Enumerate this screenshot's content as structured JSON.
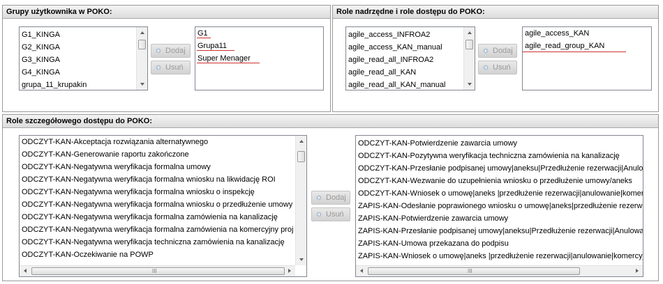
{
  "panels": {
    "groups": {
      "title": "Grupy użytkownika w POKO:"
    },
    "parent_roles": {
      "title": "Role nadrzędne i role dostępu do POKO:"
    },
    "detailed_roles": {
      "title": "Role szczegółowego dostępu do POKO:"
    }
  },
  "groups": {
    "available": [
      "G1_KINGA",
      "G2_KINGA",
      "G3_KINGA",
      "G4_KINGA",
      "grupa_11_krupakin"
    ],
    "assigned": [
      "G1",
      "Grupa11",
      "Super Menager"
    ],
    "add_label": "Dodaj",
    "remove_label": "Usuń"
  },
  "parent_roles": {
    "available": [
      "agile_access_INFROA2",
      "agile_access_KAN_manual",
      "agile_read_all_INFROA2",
      "agile_read_all_KAN",
      "agile_read_all_KAN_manual"
    ],
    "assigned": [
      "agile_access_KAN",
      "agile_read_group_KAN"
    ],
    "add_label": "Dodaj",
    "remove_label": "Usuń"
  },
  "detailed_roles": {
    "available": [
      "ODCZYT-KAN-Akceptacja rozwiązania alternatywnego",
      "ODCZYT-KAN-Generowanie raportu zakończone",
      "ODCZYT-KAN-Negatywna weryfikacja formalna umowy",
      "ODCZYT-KAN-Negatywna weryfikacja formalna wniosku na likwidację ROI",
      "ODCZYT-KAN-Negatywna weryfikacja formalna wniosku o inspekcję",
      "ODCZYT-KAN-Negatywna weryfikacja formalna wniosku o przedłużenie umowy",
      "ODCZYT-KAN-Negatywna weryfikacja formalna zamówienia na kanalizację",
      "ODCZYT-KAN-Negatywna weryfikacja formalna zamówienia na komercyjny proj",
      "ODCZYT-KAN-Negatywna weryfikacja techniczna zamówienia na kanalizację",
      "ODCZYT-KAN-Oczekiwanie na POWP"
    ],
    "assigned": [
      "ODCZYT-KAN-Potwierdzenie zawarcia umowy",
      "ODCZYT-KAN-Pozytywna weryfikacja techniczna zamówienia na kanalizację",
      "ODCZYT-KAN-Przesłanie podpisanej umowy|aneksu|Przedłużenie rezerwacji|Anulow",
      "ODCZYT-KAN-Wezwanie do uzupełnienia wniosku o przedłużenie umowy/aneks",
      "ODCZYT-KAN-Wniosek o umowę|aneks |przedłużenie rezerwacji|anulowanie|komerc",
      "ZAPIS-KAN-Odesłanie poprawionego wniosku o umowę|aneks|przedłużenie rezerw",
      "ZAPIS-KAN-Potwierdzenie zawarcia umowy",
      "ZAPIS-KAN-Przesłanie podpisanej umowy|aneksu|Przedłużenie rezerwacji|Anulowa",
      "ZAPIS-KAN-Umowa przekazana do podpisu",
      "ZAPIS-KAN-Wniosek o umowę|aneks |przedłużenie rezerwacji|anulowanie|komercyj"
    ],
    "add_label": "Dodaj",
    "remove_label": "Usuń"
  },
  "scroll_grip": "III",
  "colors": {
    "annotation_red": "#d03030",
    "button_text_disabled": "#9a9a9a",
    "header_bg": "#dcdcdc"
  }
}
